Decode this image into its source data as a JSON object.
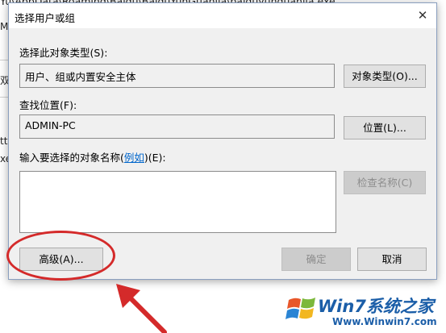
{
  "background": {
    "path_text": "Yu\\AppData\\Roaming\\Baidu\\BaiduYunGuanjia\\baiduyunguanjia.exe",
    "left_fragments": [
      "M",
      "双",
      "ttr",
      "xe"
    ]
  },
  "dialog": {
    "title": "选择用户或组",
    "close_glyph": "✕",
    "object_type": {
      "label": "选择此对象类型(S):",
      "value": "用户、组或内置安全主体",
      "button": "对象类型(O)..."
    },
    "location": {
      "label": "查找位置(F):",
      "value": "ADMIN-PC",
      "button": "位置(L)..."
    },
    "names": {
      "label_prefix": "输入要选择的对象名称(",
      "label_link": "例如",
      "label_suffix": ")(E):",
      "value": "",
      "check_button": "检查名称(C)"
    },
    "advanced_button": "高级(A)...",
    "ok_button": "确定",
    "cancel_button": "取消"
  },
  "annotation_color": "#d42a2a",
  "watermark": {
    "brand": "Win7系统之家",
    "url": "Www.Winwin7.com",
    "brand_color": "#1b5ea8"
  }
}
